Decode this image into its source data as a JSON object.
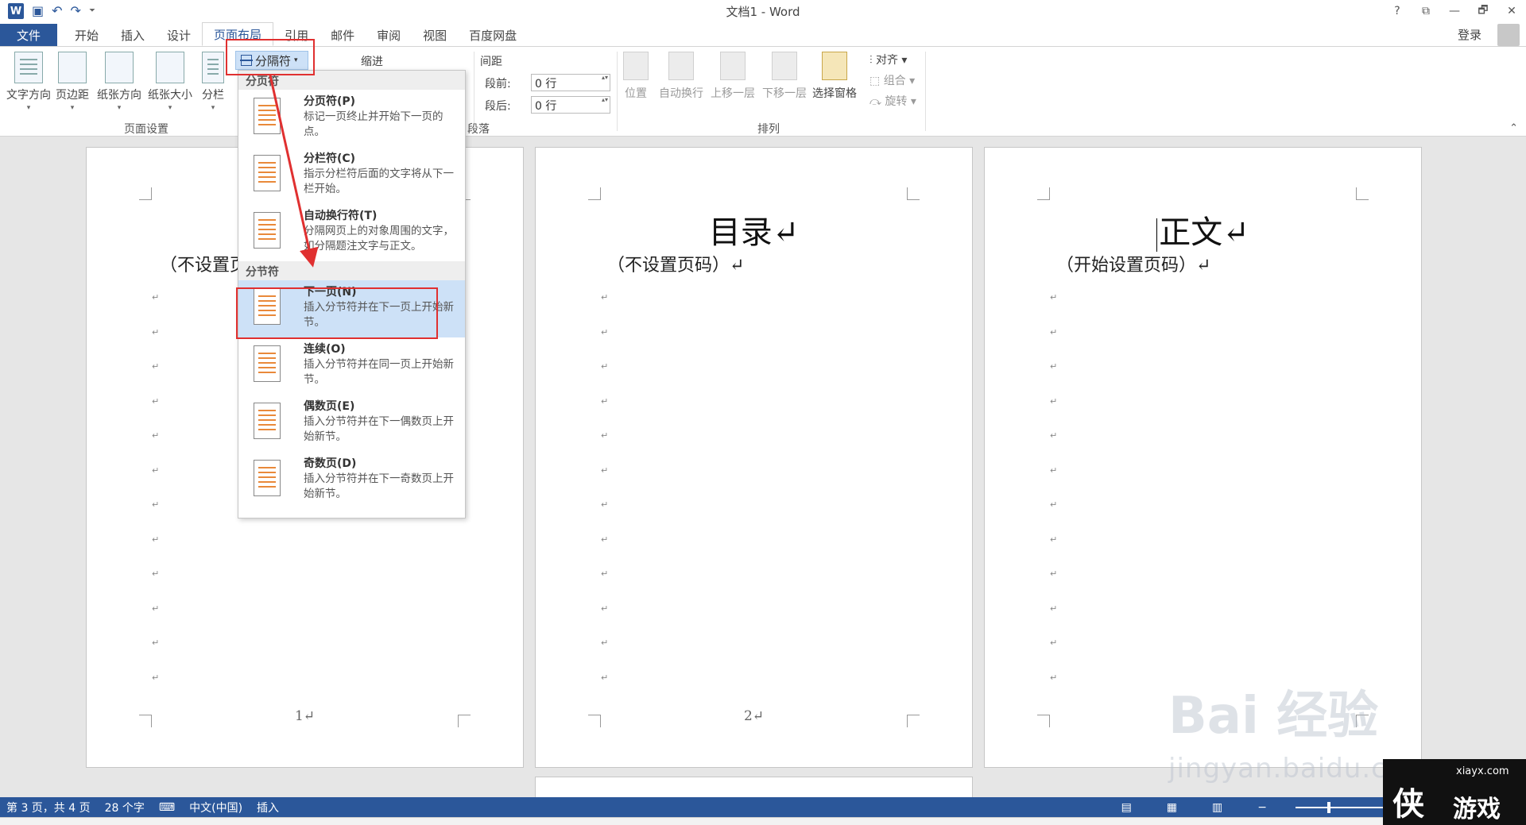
{
  "window": {
    "title": "文档1 - Word",
    "controls": [
      "?",
      "⧉",
      "—",
      "🗗",
      "✕"
    ]
  },
  "qat": {
    "logo": "W",
    "save_icon": "save-icon",
    "undo": "↶",
    "redo": "↷",
    "customize": "⏷"
  },
  "tabs": {
    "file": "文件",
    "items": [
      "开始",
      "插入",
      "设计",
      "页面布局",
      "引用",
      "邮件",
      "审阅",
      "视图",
      "百度网盘"
    ],
    "active": "页面布局",
    "login": "登录"
  },
  "ribbon": {
    "page_setup": {
      "buttons": [
        "文字方向",
        "页边距",
        "纸张方向",
        "纸张大小",
        "分栏"
      ],
      "group_label": "页面设置",
      "breaks_button": "分隔符"
    },
    "indent": {
      "label": "缩进"
    },
    "spacing": {
      "label": "间距",
      "before_label": "段前:",
      "before_value": "0 行",
      "after_label": "段后:",
      "after_value": "0 行"
    },
    "paragraph": {
      "group_label": "段落"
    },
    "arrange": {
      "buttons": [
        "位置",
        "自动换行",
        "上移一层",
        "下移一层",
        "选择窗格"
      ],
      "small": [
        "对齐",
        "组合",
        "旋转"
      ],
      "group_label": "排列"
    }
  },
  "dropdown": {
    "page_breaks_header": "分页符",
    "page_breaks": [
      {
        "title": "分页符(P)",
        "desc": "标记一页终止并开始下一页的点。"
      },
      {
        "title": "分栏符(C)",
        "desc": "指示分栏符后面的文字将从下一栏开始。"
      },
      {
        "title": "自动换行符(T)",
        "desc": "分隔网页上的对象周围的文字，如分隔题注文字与正文。"
      }
    ],
    "section_breaks_header": "分节符",
    "section_breaks": [
      {
        "title": "下一页(N)",
        "desc": "插入分节符并在下一页上开始新节。"
      },
      {
        "title": "连续(O)",
        "desc": "插入分节符并在同一页上开始新节。"
      },
      {
        "title": "偶数页(E)",
        "desc": "插入分节符并在下一偶数页上开始新节。"
      },
      {
        "title": "奇数页(D)",
        "desc": "插入分节符并在下一奇数页上开始新节。"
      }
    ],
    "selected": "下一页(N)"
  },
  "pages": [
    {
      "heading": "",
      "subtitle": "（不设置页",
      "page_number": "1↵"
    },
    {
      "heading": "目录↵",
      "subtitle": "（不设置页码）↵",
      "page_number": "2↵"
    },
    {
      "heading": "正文↵",
      "subtitle": "（开始设置页码）↵",
      "page_number": ""
    }
  ],
  "paragraph_mark": "↵",
  "statusbar": {
    "page": "第 3 页，共 4 页",
    "words": "28 个字",
    "lang": "中文(中国)",
    "mode": "插入"
  },
  "watermark": {
    "brand": "Bai 经验",
    "url": "jingyan.baidu.com",
    "site": "xiayx.com",
    "name": "侠 游戏"
  },
  "colors": {
    "accent": "#2b579a",
    "highlight": "#e03030",
    "selected": "#cde1f7"
  }
}
